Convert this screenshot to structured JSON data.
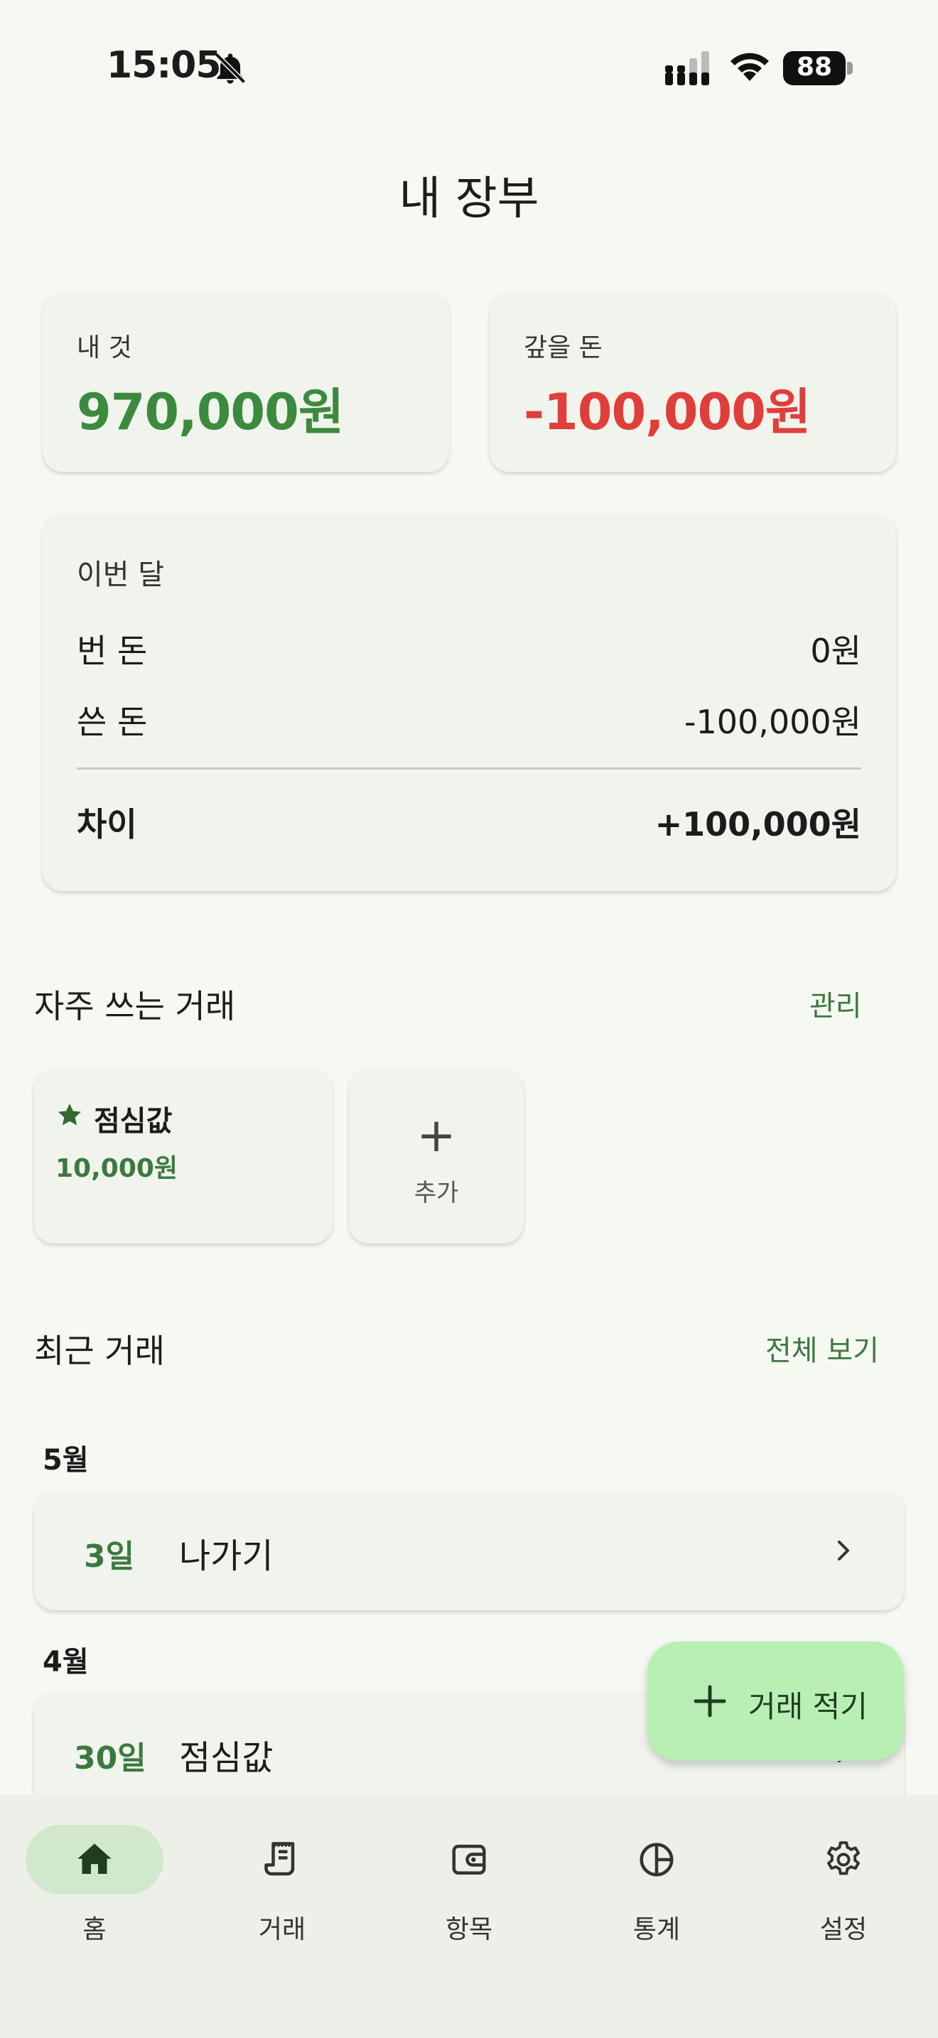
{
  "status_bar": {
    "time": "15:05",
    "battery": "88"
  },
  "header": {
    "title": "내 장부"
  },
  "balances": {
    "mine": {
      "label": "내 것",
      "amount": "970,000원"
    },
    "owed": {
      "label": "갚을 돈",
      "amount": "-100,000원"
    }
  },
  "monthly": {
    "title": "이번 달",
    "earned_label": "번 돈",
    "earned_value": "0원",
    "spent_label": "쓴 돈",
    "spent_value": "-100,000원",
    "diff_label": "차이",
    "diff_value": "+100,000원"
  },
  "frequent": {
    "title": "자주 쓰는 거래",
    "manage_label": "관리",
    "items": [
      {
        "name": "점심값",
        "amount": "10,000원"
      }
    ],
    "add_label": "추가"
  },
  "recent": {
    "title": "최근 거래",
    "view_all_label": "전체 보기",
    "groups": [
      {
        "month": "5월",
        "items": [
          {
            "day": "3일",
            "name": "나가기"
          }
        ]
      },
      {
        "month": "4월",
        "items": [
          {
            "day": "30일",
            "name": "점심값"
          }
        ]
      }
    ]
  },
  "fab": {
    "label": "거래 적기"
  },
  "nav": {
    "items": [
      {
        "label": "홈",
        "icon": "home-icon",
        "active": true
      },
      {
        "label": "거래",
        "icon": "receipt-icon"
      },
      {
        "label": "항목",
        "icon": "wallet-icon"
      },
      {
        "label": "통계",
        "icon": "pie-chart-icon"
      },
      {
        "label": "설정",
        "icon": "gear-icon"
      }
    ]
  },
  "colors": {
    "positive": "#3b8a3e",
    "negative": "#e03e3a",
    "accent": "#3b7a3e",
    "fab": "#b7efb5",
    "nav_active": "#d1e8cd"
  }
}
